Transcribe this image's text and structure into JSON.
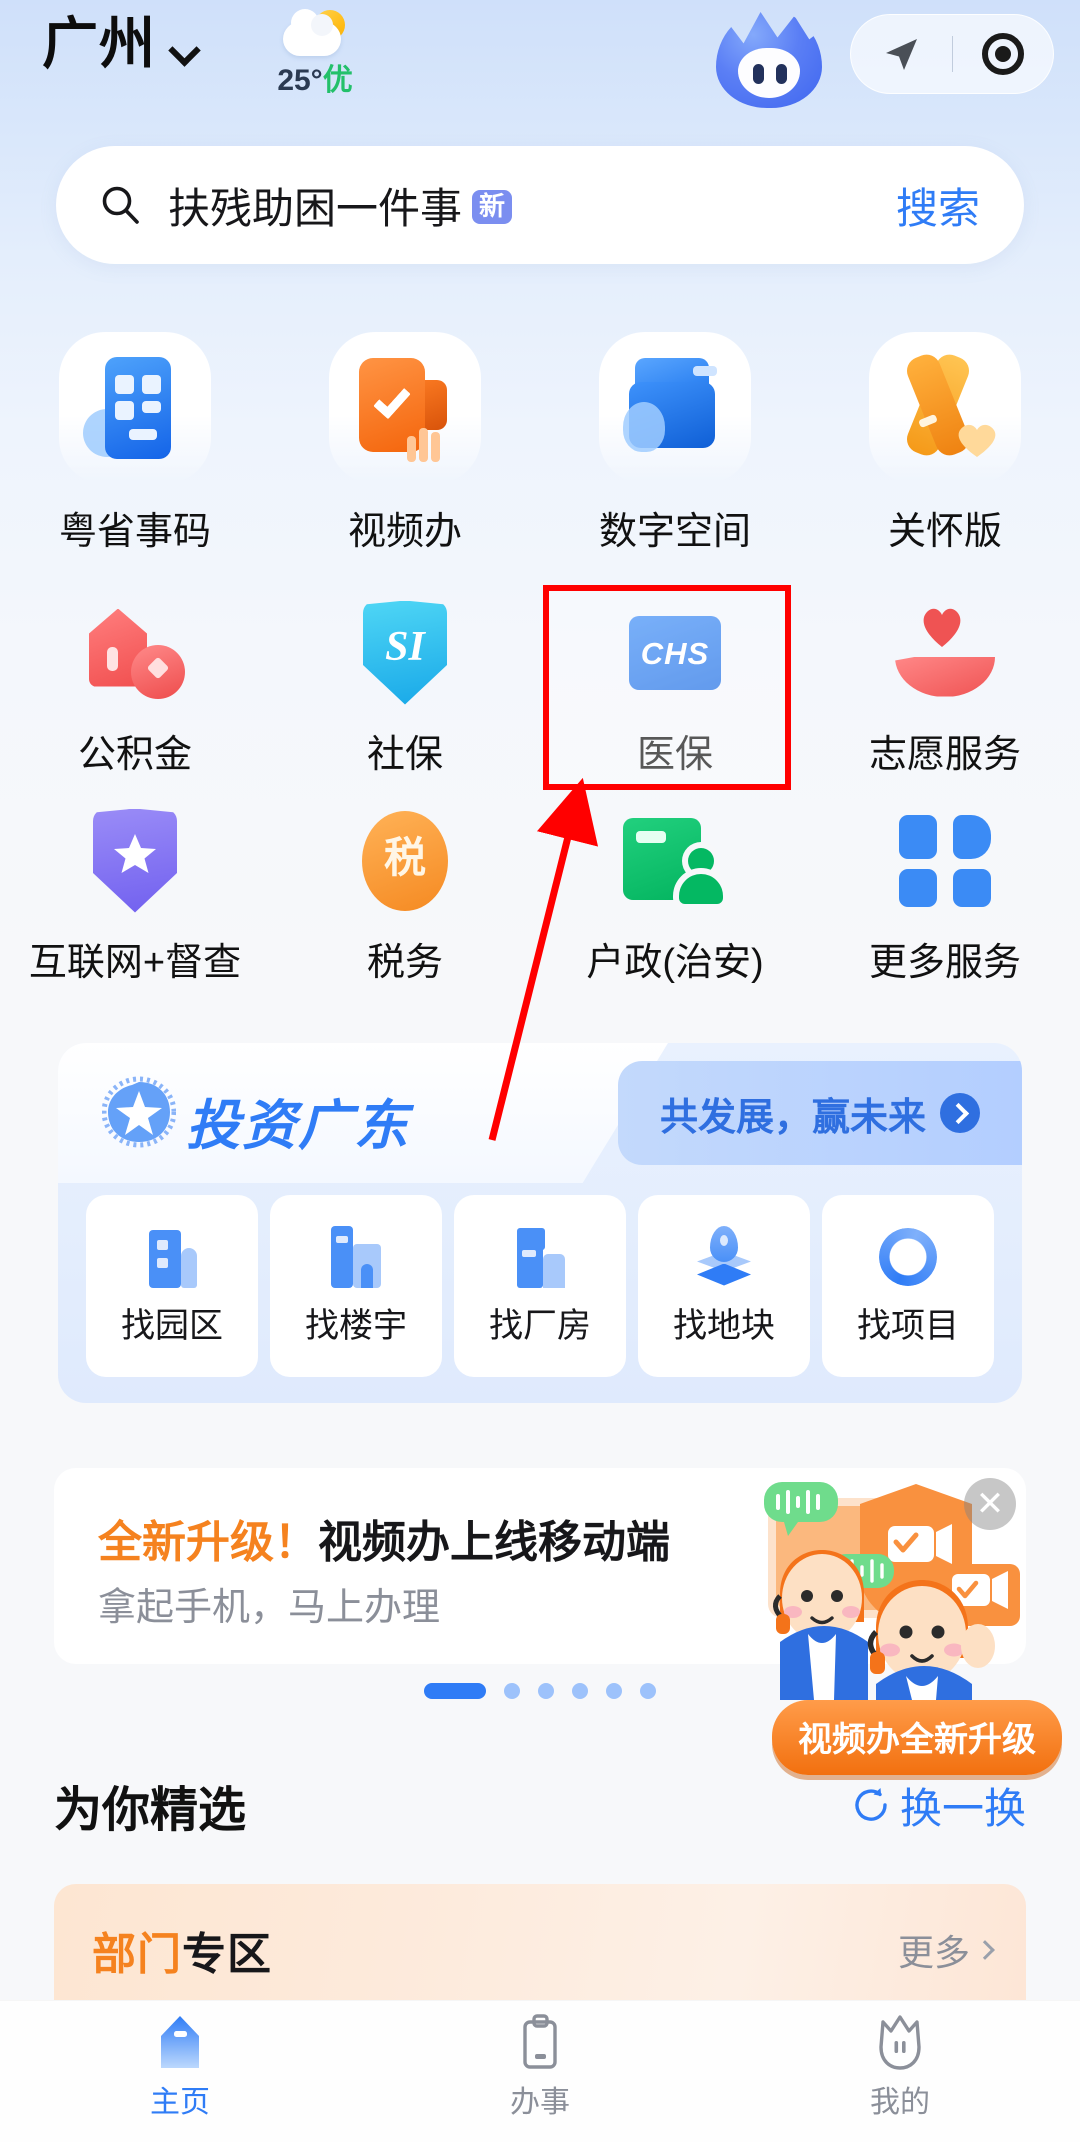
{
  "header": {
    "city": "广州",
    "city_chevron_icon": "chevron-down-icon",
    "weather_icon": "sun-behind-cloud-icon",
    "weather_temp": "25°",
    "weather_air_quality": "优",
    "mascot_icon": "mascot-avatar-icon",
    "capsule": {
      "navigate_icon": "navigation-arrow-icon",
      "record_icon": "record-dot-icon"
    }
  },
  "search": {
    "icon": "search-icon",
    "keyword": "扶残助困一件事",
    "badge": "新",
    "button_label": "搜索"
  },
  "grid": {
    "row1": [
      {
        "label": "粤省事码",
        "icon": "qr-card-icon"
      },
      {
        "label": "视频办",
        "icon": "video-check-icon"
      },
      {
        "label": "数字空间",
        "icon": "digital-folder-icon"
      },
      {
        "label": "关怀版",
        "icon": "care-ribbon-icon"
      }
    ],
    "row2": [
      {
        "label": "公积金",
        "icon": "house-coin-icon"
      },
      {
        "label": "社保",
        "icon": "si-shield-icon",
        "icon_text": "SI"
      },
      {
        "label": "医保",
        "icon": "chs-card-icon",
        "icon_text": "CHS",
        "highlighted": true
      },
      {
        "label": "志愿服务",
        "icon": "heart-hand-icon"
      }
    ],
    "row3": [
      {
        "label": "互联网+督查",
        "icon": "star-shield-icon"
      },
      {
        "label": "税务",
        "icon": "tax-oval-icon",
        "icon_text": "税"
      },
      {
        "label": "户政(治安)",
        "icon": "id-card-person-icon"
      },
      {
        "label": "更多服务",
        "icon": "grid-more-icon"
      }
    ]
  },
  "annotation": {
    "highlight_color": "#ff0000",
    "highlight_target": "医保",
    "arrow_icon": "red-pointer-arrow-icon"
  },
  "invest": {
    "logo_icon": "invest-swirl-logo-icon",
    "title": "投资广东",
    "slogan": "共发展，赢未来",
    "slogan_chevron_icon": "chevron-right-circle-icon",
    "items": [
      {
        "label": "找园区",
        "icon": "park-building-icon"
      },
      {
        "label": "找楼宇",
        "icon": "office-tower-icon"
      },
      {
        "label": "找厂房",
        "icon": "factory-icon"
      },
      {
        "label": "找地块",
        "icon": "land-pin-icon"
      },
      {
        "label": "找项目",
        "icon": "project-spark-icon"
      }
    ]
  },
  "ad": {
    "title_highlight": "全新升级！",
    "title_rest": "视频办上线移动端",
    "subtitle": "拿起手机，马上办理",
    "close_icon": "close-icon",
    "art_icon": "video-service-agents-illustration",
    "badge": "视频办全新升级",
    "pagination": {
      "total": 6,
      "active_index": 0
    }
  },
  "featured": {
    "title": "为你精选",
    "refresh_icon": "refresh-icon",
    "refresh_label": "换一换"
  },
  "dept_card": {
    "title_orange": "部门",
    "title_black": "专区",
    "more_label": "更多",
    "more_chevron_icon": "chevron-right-icon"
  },
  "tabbar": [
    {
      "label": "主页",
      "icon": "home-icon",
      "active": true
    },
    {
      "label": "办事",
      "icon": "clipboard-icon",
      "active": false
    },
    {
      "label": "我的",
      "icon": "profile-mascot-icon",
      "active": false
    }
  ],
  "colors": {
    "accent_blue": "#2f7cf6",
    "accent_orange": "#f5821f",
    "highlight_red": "#ff0000",
    "green": "#23c06a"
  }
}
